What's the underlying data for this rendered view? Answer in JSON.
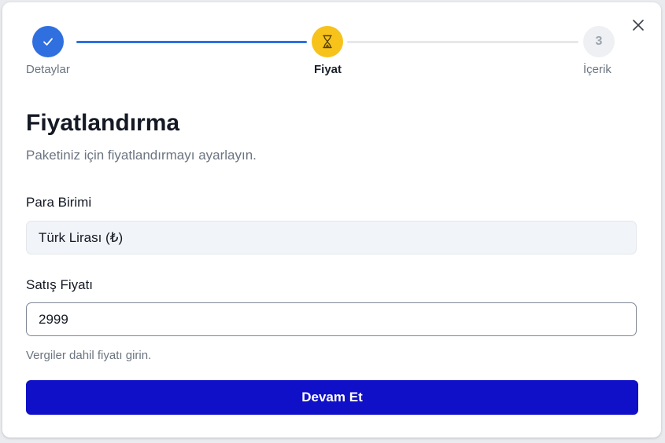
{
  "colors": {
    "step_done": "#2f6fe0",
    "step_active": "#f7c21a",
    "step_pending": "#eef0f3",
    "primary_button": "#1010c8"
  },
  "stepper": {
    "steps": [
      {
        "label": "Detaylar",
        "status": "done",
        "icon": "check-icon"
      },
      {
        "label": "Fiyat",
        "status": "active",
        "icon": "hourglass-icon"
      },
      {
        "label": "İçerik",
        "status": "pending",
        "number": "3"
      }
    ]
  },
  "close_icon": "close-icon",
  "page": {
    "title": "Fiyatlandırma",
    "subtitle": "Paketiniz için fiyatlandırmayı ayarlayın."
  },
  "form": {
    "currency": {
      "label": "Para Birimi",
      "value": "Türk Lirası (₺)"
    },
    "sale_price": {
      "label": "Satış Fiyatı",
      "value": "2999",
      "hint": "Vergiler dahil fiyatı girin."
    },
    "submit_label": "Devam Et"
  }
}
